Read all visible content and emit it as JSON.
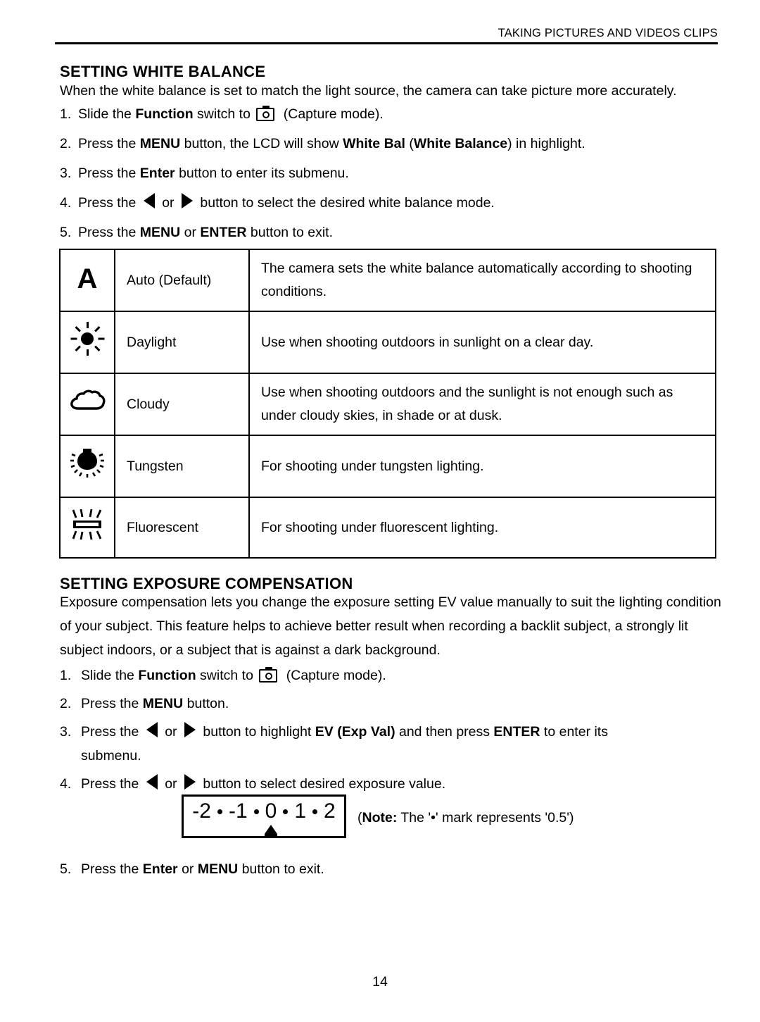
{
  "header": {
    "running_title": "TAKING PICTURES AND VIDEOS CLIPS"
  },
  "white_balance": {
    "title": "SETTING WHITE BALANCE",
    "intro": "When the white balance is set to match the light source, the camera can take picture more accurately.",
    "steps": [
      {
        "num": "1.",
        "pre": "Slide the ",
        "bold1": "Function",
        "mid": " switch to ",
        "icon": "camera-capture-mode-icon",
        "post": " (Capture mode)."
      },
      {
        "num": "2.",
        "pre": "Press the ",
        "bold1": "MENU",
        "mid": " button, the LCD will show ",
        "bold2": "White Bal",
        "mid2": " (",
        "bold3": "White Balance",
        "post": ") in highlight."
      },
      {
        "num": "3.",
        "pre": "Press the ",
        "bold1": "Enter",
        "post": " button to enter its submenu."
      },
      {
        "num": "4.",
        "pre": "Press the ",
        "icon_left": "triangle-left-icon",
        "mid": " or ",
        "icon_right": "triangle-right-icon",
        "post": " button to select the desired white balance mode."
      },
      {
        "num": "5.",
        "pre": "Press the ",
        "bold1": "MENU",
        "mid": " or ",
        "bold2": "ENTER",
        "post": " button to exit."
      }
    ],
    "table": {
      "rows": [
        {
          "icon": "auto-a-icon",
          "label": "Auto (Default)",
          "desc_line1": "The camera sets the white balance automatically according to shooting",
          "desc_line2": "conditions."
        },
        {
          "icon": "sun-icon",
          "label": "Daylight",
          "desc_line1": "Use when shooting outdoors in sunlight on a clear day.",
          "desc_line2": ""
        },
        {
          "icon": "cloud-icon",
          "label": "Cloudy",
          "desc_line1": "Use when shooting outdoors and the sunlight is not enough such as",
          "desc_line2": "under cloudy skies, in shade or at dusk."
        },
        {
          "icon": "bulb-icon",
          "label": "Tungsten",
          "desc_line1": "For shooting under tungsten lighting.",
          "desc_line2": ""
        },
        {
          "icon": "fluorescent-tube-icon",
          "label": "Fluorescent",
          "desc_line1": "For shooting under fluorescent lighting.",
          "desc_line2": ""
        }
      ]
    }
  },
  "exposure_compensation": {
    "title": "SETTING EXPOSURE COMPENSATION",
    "intro": "Exposure compensation lets you change the exposure setting EV value manually to suit the lighting condition of your subject. This feature helps to achieve better result when recording a backlit subject, a strongly lit subject indoors, or a subject that is against a dark background.",
    "steps": [
      {
        "num": "1.",
        "pre": "Slide the ",
        "bold1": "Function",
        "mid": " switch to ",
        "icon": "camera-capture-mode-icon",
        "post": " (Capture mode)."
      },
      {
        "num": "2.",
        "pre": "Press the ",
        "bold1": "MENU",
        "post": " button."
      },
      {
        "num": "3.",
        "pre": "Press the ",
        "icon_left": "triangle-left-icon",
        "mid": " or ",
        "icon_right": "triangle-right-icon",
        "mid2": " button to highlight ",
        "bold1": "EV (Exp Val)",
        "mid3": " and then press ",
        "bold2": "ENTER",
        "post": " to enter its",
        "cont": "submenu."
      },
      {
        "num": "4.",
        "pre": "Press the ",
        "icon_left": "triangle-left-icon",
        "mid": " or ",
        "icon_right": "triangle-right-icon",
        "post": " button to select desired exposure value."
      }
    ],
    "ev_scale": {
      "values": [
        "-2",
        "-1",
        "0",
        "1",
        "2"
      ],
      "dot_separator": "•",
      "marker_under": "0",
      "marker_name": "ev-position-marker"
    },
    "note": {
      "open_paren": "(",
      "label": "Note:",
      "text": " The '•' mark represents '0.5')"
    },
    "final_step": {
      "num": "5.",
      "pre": "Press the ",
      "bold1": "Enter",
      "mid": " or ",
      "bold2": "MENU",
      "post": " button to exit."
    }
  },
  "footer": {
    "page_number": "14"
  }
}
